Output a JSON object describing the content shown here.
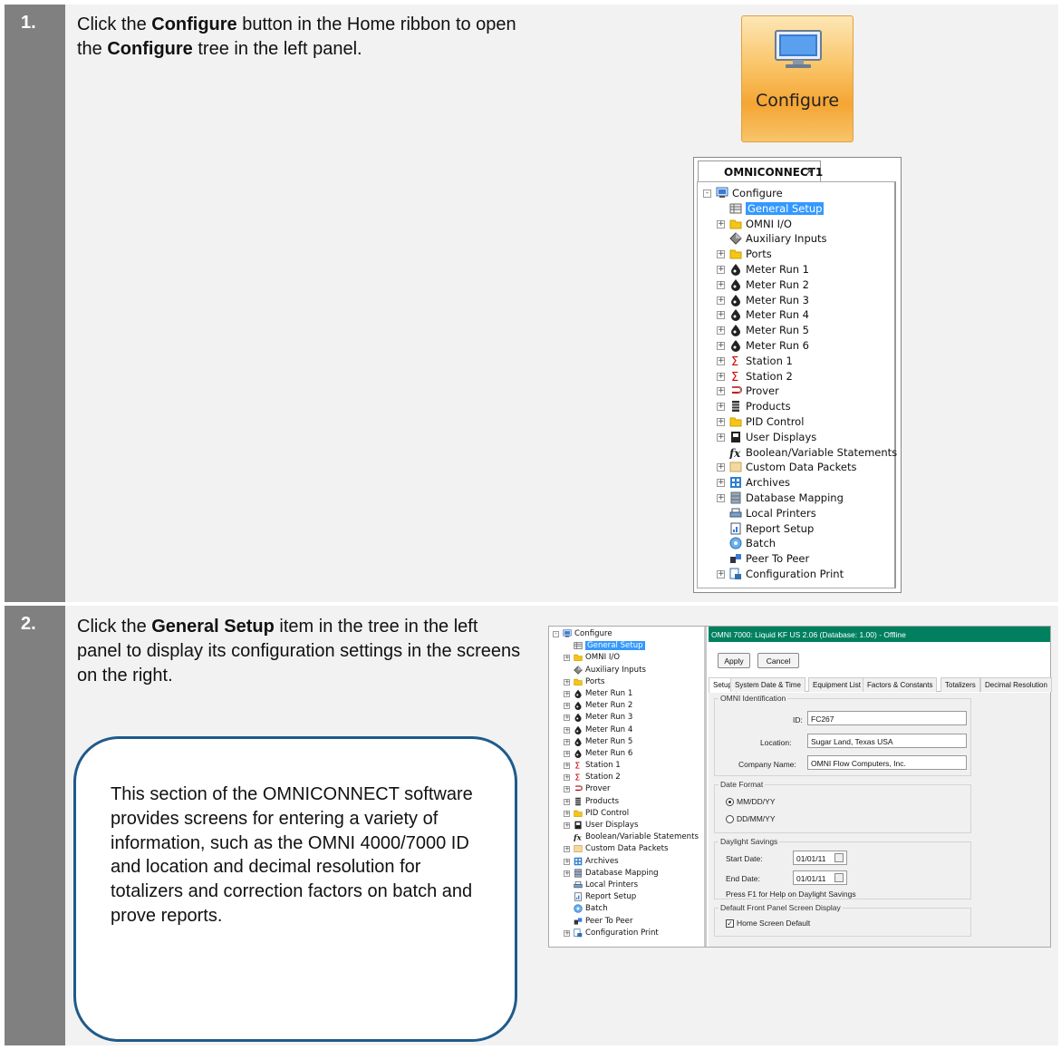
{
  "steps": [
    {
      "number": "1.",
      "text": [
        {
          "t": "Click the "
        },
        {
          "b": "Configure"
        },
        {
          "t": " button in the Home ribbon to open the "
        },
        {
          "b": "Configure"
        },
        {
          "t": " tree in the left panel."
        }
      ]
    },
    {
      "number": "2.",
      "text": [
        {
          "t": "Click the "
        },
        {
          "b": "General Setup"
        },
        {
          "t": " item in the tree in the left panel to display its configuration settings in the screens on the right."
        }
      ]
    }
  ],
  "configure_button": {
    "label": "Configure",
    "icon": "monitor-icon"
  },
  "tree_tab": {
    "label": "OMNICONNECT1",
    "close": "×"
  },
  "tree": [
    {
      "label": "Configure",
      "level": 0,
      "exp": "-",
      "icon": "monitor-icon"
    },
    {
      "label": "General Setup",
      "level": 1,
      "exp": "",
      "icon": "grid-icon",
      "selected": true
    },
    {
      "label": "OMNI I/O",
      "level": 1,
      "exp": "+",
      "icon": "folder-icon"
    },
    {
      "label": "Auxiliary Inputs",
      "level": 1,
      "exp": "",
      "icon": "diamond-icon"
    },
    {
      "label": "Ports",
      "level": 1,
      "exp": "+",
      "icon": "folder-icon"
    },
    {
      "label": "Meter Run 1",
      "level": 1,
      "exp": "+",
      "icon": "drop-icon"
    },
    {
      "label": "Meter Run 2",
      "level": 1,
      "exp": "+",
      "icon": "drop-icon"
    },
    {
      "label": "Meter Run 3",
      "level": 1,
      "exp": "+",
      "icon": "drop-icon"
    },
    {
      "label": "Meter Run 4",
      "level": 1,
      "exp": "+",
      "icon": "drop-icon"
    },
    {
      "label": "Meter Run 5",
      "level": 1,
      "exp": "+",
      "icon": "drop-icon"
    },
    {
      "label": "Meter Run 6",
      "level": 1,
      "exp": "+",
      "icon": "drop-icon"
    },
    {
      "label": "Station 1",
      "level": 1,
      "exp": "+",
      "icon": "sigma-icon"
    },
    {
      "label": "Station 2",
      "level": 1,
      "exp": "+",
      "icon": "sigma-icon"
    },
    {
      "label": "Prover",
      "level": 1,
      "exp": "+",
      "icon": "prover-icon"
    },
    {
      "label": "Products",
      "level": 1,
      "exp": "+",
      "icon": "barrel-icon"
    },
    {
      "label": "PID Control",
      "level": 1,
      "exp": "+",
      "icon": "folder-icon"
    },
    {
      "label": "User Displays",
      "level": 1,
      "exp": "+",
      "icon": "display-icon"
    },
    {
      "label": "Boolean/Variable Statements",
      "level": 1,
      "exp": "",
      "icon": "fx-icon"
    },
    {
      "label": "Custom Data Packets",
      "level": 1,
      "exp": "+",
      "icon": "packet-icon"
    },
    {
      "label": "Archives",
      "level": 1,
      "exp": "+",
      "icon": "archive-icon"
    },
    {
      "label": "Database Mapping",
      "level": 1,
      "exp": "+",
      "icon": "database-icon"
    },
    {
      "label": "Local Printers",
      "level": 1,
      "exp": "",
      "icon": "printer-icon"
    },
    {
      "label": "Report Setup",
      "level": 1,
      "exp": "",
      "icon": "report-icon"
    },
    {
      "label": "Batch",
      "level": 1,
      "exp": "",
      "icon": "batch-icon"
    },
    {
      "label": "Peer To Peer",
      "level": 1,
      "exp": "",
      "icon": "peer-icon"
    },
    {
      "label": "Configuration Print",
      "level": 1,
      "exp": "+",
      "icon": "print-config-icon"
    }
  ],
  "screen": {
    "title": "OMNI 7000:  Liquid KF US 2.06 (Database: 1.00) - Offline",
    "apply": "Apply",
    "cancel": "Cancel",
    "tabs": [
      "Setup",
      "System Date & Time",
      "Equipment List",
      "Factors & Constants",
      "Totalizers",
      "Decimal Resolution"
    ],
    "identification": {
      "group": "OMNI Identification",
      "id_label": "ID:",
      "id_value": "FC267",
      "location_label": "Location:",
      "location_value": "Sugar Land, Texas USA",
      "company_label": "Company Name:",
      "company_value": "OMNI Flow Computers, Inc."
    },
    "date_format": {
      "group": "Date Format",
      "opt1": "MM/DD/YY",
      "opt2": "DD/MM/YY",
      "selected": "MM/DD/YY"
    },
    "daylight": {
      "group": "Daylight Savings",
      "start_label": "Start Date:",
      "start_value": "01/01/11",
      "end_label": "End Date:",
      "end_value": "01/01/11",
      "help": "Press F1 for Help on Daylight Savings"
    },
    "front_panel": {
      "group": "Default Front Panel Screen Display",
      "checkbox_label": "Home Screen Default",
      "checked": true
    }
  },
  "callout": "This section of the OMNICONNECT software provides screens for entering a variety of information, such as the OMNI 4000/7000 ID and location and decimal resolution for totalizers and correction factors on batch and prove reports.",
  "colors": {
    "number_bar": "#808080",
    "row_bg": "#f2f2f2",
    "title_bar": "#00805f",
    "callout_border": "#1f5a8a",
    "selection": "#3399ff"
  }
}
